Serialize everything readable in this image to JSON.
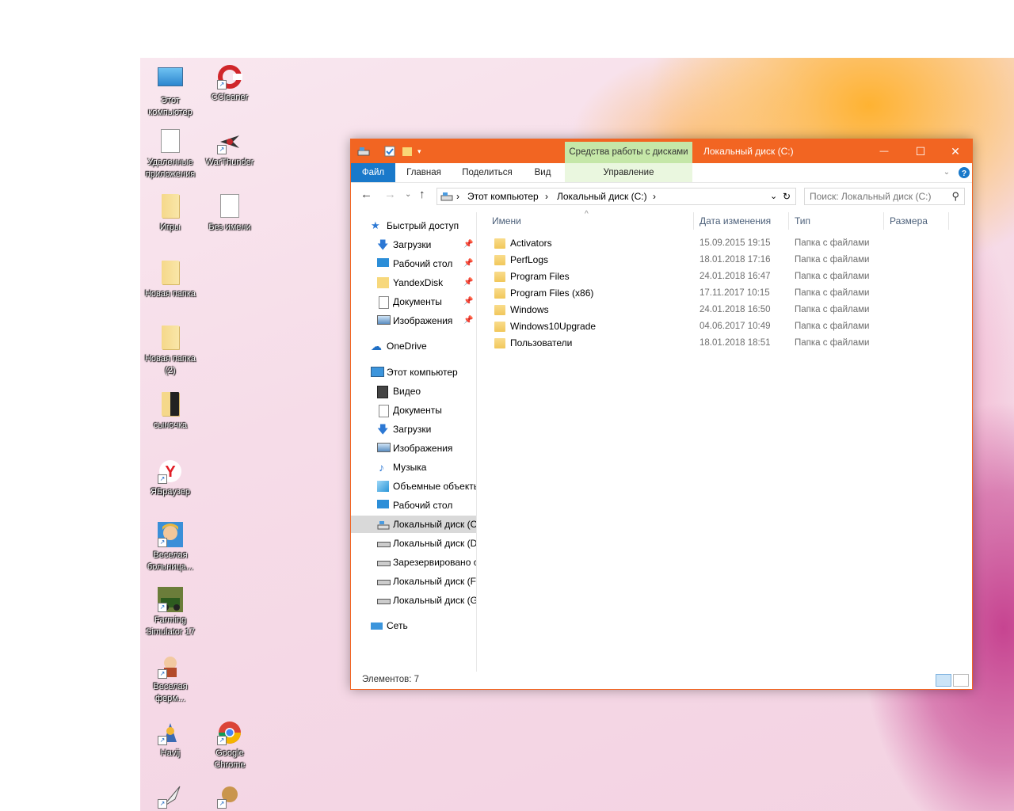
{
  "desktop": {
    "icons": [
      {
        "label": "Этот компьютер",
        "icon": "computer-icon"
      },
      {
        "label": "CCleaner",
        "icon": "ccleaner-icon"
      },
      {
        "label": "Удаленные приложения",
        "icon": "file-icon"
      },
      {
        "label": "WarThunder",
        "icon": "warthunder-icon"
      },
      {
        "label": "Игры",
        "icon": "folder-icon"
      },
      {
        "label": "Без имени",
        "icon": "file-icon"
      },
      {
        "label": "Новая папка",
        "icon": "folder-icon"
      },
      {
        "label": "Новая папка (2)",
        "icon": "folder-icon"
      },
      {
        "label": "сыночка",
        "icon": "folder-icon"
      },
      {
        "label": "ЯБраузер",
        "icon": "yandex-browser-icon"
      },
      {
        "label": "Веселая больница...",
        "icon": "game-icon"
      },
      {
        "label": "Farming Simulator 17",
        "icon": "game-icon"
      },
      {
        "label": "Веселая ферм...",
        "icon": "game-icon"
      },
      {
        "label": "Havij",
        "icon": "havij-icon"
      },
      {
        "label": "Google Chrome",
        "icon": "chrome-icon"
      }
    ]
  },
  "window": {
    "title": "Локальный диск (C:)",
    "context_tab": "Средства работы с дисками",
    "context_sub": "Управление",
    "ribbon_tabs": [
      "Файл",
      "Главная",
      "Поделиться",
      "Вид"
    ],
    "buttons": {
      "minimize": "—",
      "maximize": "☐",
      "close": "✕"
    },
    "address": {
      "crumbs": [
        "Этот компьютер",
        "Локальный диск (C:)"
      ],
      "sep": "›"
    },
    "search": {
      "placeholder": "Поиск: Локальный диск (C:)"
    },
    "nav": {
      "quick_access": "Быстрый доступ",
      "pinned": [
        "Загрузки",
        "Рабочий стол",
        "YandexDisk",
        "Документы",
        "Изображения"
      ],
      "onedrive": "OneDrive",
      "this_pc": "Этот компьютер",
      "pc_items": [
        "Видео",
        "Документы",
        "Загрузки",
        "Изображения",
        "Музыка",
        "Объемные объекты",
        "Рабочий стол",
        "Локальный диск (C:)",
        "Локальный диск (D:)",
        "Зарезервировано системой",
        "Локальный диск (F:)",
        "Локальный диск (G:)"
      ],
      "network": "Сеть"
    },
    "columns": {
      "name": "Имени",
      "date": "Дата изменения",
      "type": "Тип",
      "size": "Размера"
    },
    "files": [
      {
        "name": "Activators",
        "date": "15.09.2015 19:15",
        "type": "Папка с файлами"
      },
      {
        "name": "PerfLogs",
        "date": "18.01.2018 17:16",
        "type": "Папка с файлами"
      },
      {
        "name": "Program Files",
        "date": "24.01.2018 16:47",
        "type": "Папка с файлами"
      },
      {
        "name": "Program Files (x86)",
        "date": "17.11.2017 10:15",
        "type": "Папка с файлами"
      },
      {
        "name": "Windows",
        "date": "24.01.2018 16:50",
        "type": "Папка с файлами"
      },
      {
        "name": "Windows10Upgrade",
        "date": "04.06.2017 10:49",
        "type": "Папка с файлами"
      },
      {
        "name": "Пользователи",
        "date": "18.01.2018 18:51",
        "type": "Папка с файлами"
      }
    ],
    "status": "Элементов: 7"
  },
  "colors": {
    "accent": "#f26522",
    "file_tab": "#1979ca",
    "context_tab": "#c5e7a8"
  }
}
